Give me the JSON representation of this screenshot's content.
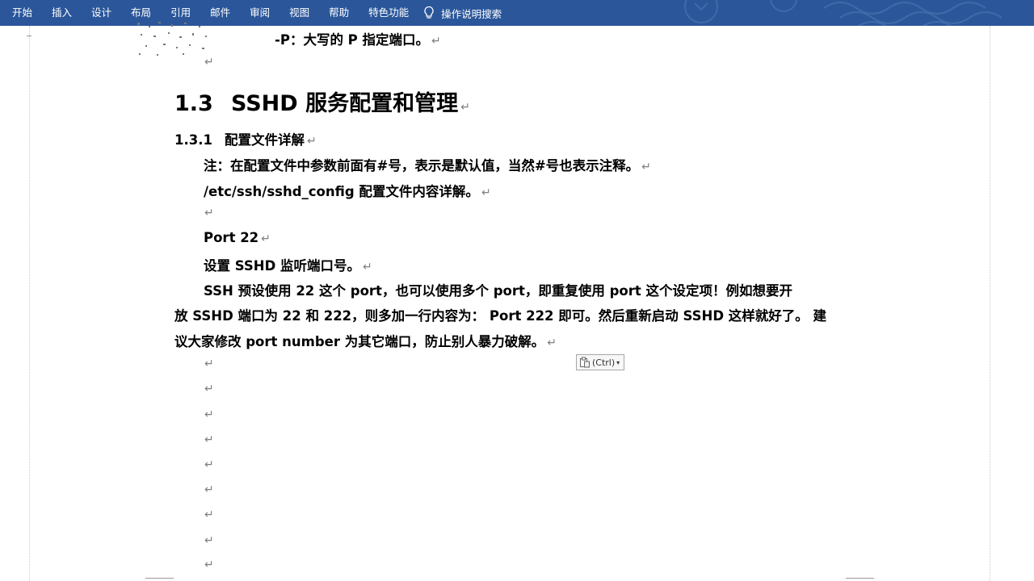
{
  "ribbon": {
    "tabs": [
      "开始",
      "插入",
      "设计",
      "布局",
      "引用",
      "邮件",
      "审阅",
      "视图",
      "帮助",
      "特色功能"
    ],
    "tell_me": "操作说明搜索"
  },
  "document": {
    "p_option": "-P：大写的 P 指定端口。",
    "heading1": {
      "number": "1.3",
      "text": "SSHD 服务配置和管理"
    },
    "heading2": {
      "number": "1.3.1",
      "text": "配置文件详解"
    },
    "note": "注：在配置文件中参数前面有#号，表示是默认值，当然#号也表示注释。",
    "config_path": "/etc/ssh/sshd_config 配置文件内容详解。",
    "port_line": "Port 22",
    "port_desc": "设置 SSHD 监听端口号。",
    "body_lines": [
      "SSH  预设使用  22  这个 port，也可以使用多个 port，即重复使用  port  这个设定项！例如想要开",
      "放 SSHD 端口为  22 和 222，则多加一行内容为：  Port 222  即可。然后重新启动 SSHD 这样就好了。 建",
      "议大家修改  port number  为其它端口，防止别人暴力破解。"
    ],
    "paragraph_mark": "↵"
  },
  "paste_options": {
    "label": "(Ctrl)"
  },
  "colors": {
    "ribbon": "#2b579a",
    "text": "#000000",
    "mark": "#7f7f7f"
  }
}
